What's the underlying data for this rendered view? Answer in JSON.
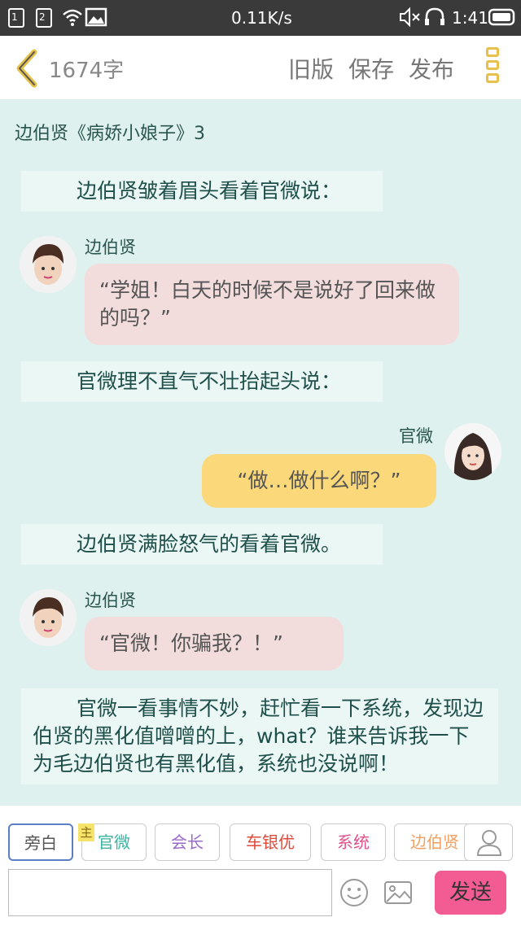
{
  "status_bar": {
    "sim1": "1",
    "sim2": "2",
    "speed": "0.11K/s",
    "time": "1:41"
  },
  "header": {
    "word_count": "1674字",
    "old_version": "旧版",
    "save": "保存",
    "publish": "发布"
  },
  "doc_title": "边伯贤《病娇小娘子》3",
  "messages": [
    {
      "type": "narration",
      "text": "边伯贤皱着眉头看着官微说："
    },
    {
      "type": "dialogue",
      "speaker": "边伯贤",
      "text": "“学姐！白天的时候不是说好了回来做的吗？”"
    },
    {
      "type": "narration",
      "text": "官微理不直气不壮抬起头说："
    },
    {
      "type": "dialogue",
      "speaker": "官微",
      "text": "“做…做什么啊？”"
    },
    {
      "type": "narration",
      "text": "边伯贤满脸怒气的看着官微。"
    },
    {
      "type": "dialogue",
      "speaker": "边伯贤",
      "text": "“官微！你骗我？！”"
    },
    {
      "type": "narration",
      "text": "官微一看事情不妙，赶忙看一下系统，发现边伯贤的黑化值噌噌的上，what？谁来告诉我一下为毛边伯贤也有黑化值，系统也没说啊！"
    }
  ],
  "roles": [
    {
      "label": "旁白",
      "color": "#555555"
    },
    {
      "label": "官微",
      "color": "#3bb3a0"
    },
    {
      "label": "会长",
      "color": "#9a6ac8"
    },
    {
      "label": "车银优",
      "color": "#e04a3a"
    },
    {
      "label": "系统",
      "color": "#e0508a"
    },
    {
      "label": "边伯贤",
      "color": "#f0a060"
    }
  ],
  "main_tag": "主",
  "send_label": "发送"
}
